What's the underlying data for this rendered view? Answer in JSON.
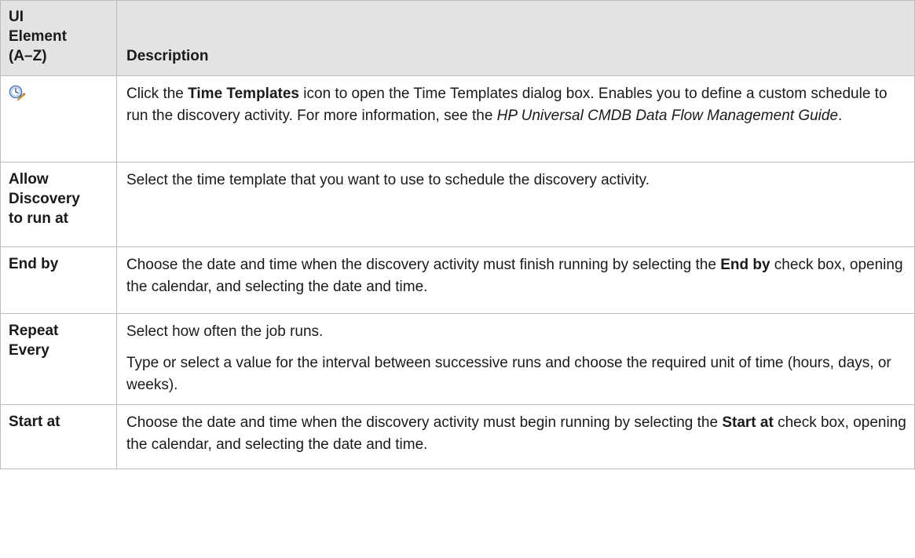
{
  "header": {
    "ui_element_label": "UI Element (A–Z)",
    "ui_element_lines": [
      "UI",
      "Element",
      "(A–Z)"
    ],
    "description_label": "Description"
  },
  "rows": [
    {
      "element_icon": "time-templates-icon",
      "description": {
        "p1_pre": "Click the ",
        "p1_bold": "Time Templates",
        "p1_mid": " icon to open the Time Templates dialog box. Enables you to define a custom schedule to run the discovery activity. For more information, see the ",
        "p1_italic": "HP Universal CMDB Data Flow Management Guide",
        "p1_post": "."
      }
    },
    {
      "element_lines": [
        "Allow",
        "Discovery",
        "to run at"
      ],
      "description": {
        "p1": "Select the time template that you want to use to schedule the discovery activity."
      }
    },
    {
      "element": "End by",
      "description": {
        "p1_pre": "Choose the date and time when the discovery activity must finish running by selecting the ",
        "p1_bold": "End by",
        "p1_post": " check box, opening the calendar, and selecting the date and time."
      }
    },
    {
      "element_lines": [
        "Repeat",
        "Every"
      ],
      "description": {
        "p1": "Select how often the job runs.",
        "p2": "Type or select a value for the interval between successive runs and choose the required unit of time (hours, days, or weeks)."
      }
    },
    {
      "element": "Start at",
      "description": {
        "p1_pre": "Choose the date and time when the discovery activity must begin running by selecting the ",
        "p1_bold": "Start at",
        "p1_post": " check box, opening the calendar, and selecting the date and time."
      }
    }
  ],
  "colors": {
    "header_bg": "#e3e3e3",
    "border": "#bdbdbd",
    "icon_clock": "#4a7fc1",
    "icon_pencil": "#e7a321"
  }
}
